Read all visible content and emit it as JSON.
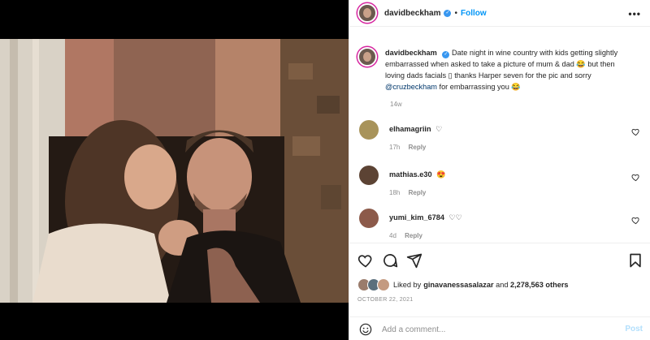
{
  "post": {
    "username": "davidbeckham",
    "verified_glyph": "✓",
    "dot": "•",
    "follow_label": "Follow",
    "more_label": "•••",
    "caption": {
      "username": "davidbeckham",
      "text_before": "Date night in wine country with kids getting slightly embarrassed when asked to take a picture of mum & dad 😂 but then loving dads facials ▯ thanks Harper seven for the pic and sorry ",
      "mention": "@cruzbeckham",
      "text_after": " for embarrassing you 😂",
      "time": "14w"
    },
    "comments": [
      {
        "username": "elhamagriin",
        "text": "♡",
        "time": "17h",
        "reply_label": "Reply"
      },
      {
        "username": "mathias.e30",
        "text": "😍",
        "time": "18h",
        "reply_label": "Reply"
      },
      {
        "username": "yumi_kim_6784",
        "text": "♡♡",
        "time": "4d",
        "reply_label": "Reply"
      }
    ],
    "likes": {
      "prefix": "Liked by ",
      "user": "ginavanessasalazar",
      "middle": " and ",
      "count": "2,278,563 others"
    },
    "date": "OCTOBER 22, 2021",
    "add_comment_placeholder": "Add a comment...",
    "post_label": "Post"
  },
  "icons": {
    "heart": "heart-icon",
    "comment": "comment-icon",
    "share": "share-icon",
    "save": "bookmark-icon",
    "emoji": "emoji-icon"
  },
  "colors": {
    "accent": "#0095f6",
    "verified": "#3897f0",
    "muted": "#8e8e8e"
  }
}
